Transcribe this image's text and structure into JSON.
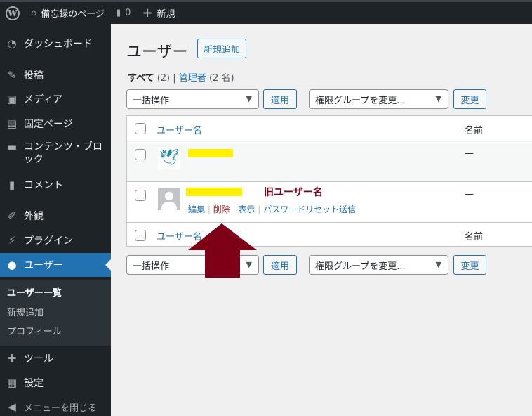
{
  "adminbar": {
    "site_name": "備忘録のページ",
    "comments_count": "0",
    "new_label": "新規"
  },
  "sidebar": {
    "items": [
      {
        "label": "ダッシュボード",
        "icon": "dashboard-icon"
      },
      {
        "label": "投稿",
        "icon": "pin-icon"
      },
      {
        "label": "メディア",
        "icon": "media-icon"
      },
      {
        "label": "固定ページ",
        "icon": "page-icon"
      },
      {
        "label": "コンテンツ・ブロック",
        "icon": "block-icon"
      },
      {
        "label": "コメント",
        "icon": "comment-icon"
      },
      {
        "label": "外観",
        "icon": "brush-icon"
      },
      {
        "label": "プラグイン",
        "icon": "plugin-icon"
      },
      {
        "label": "ユーザー",
        "icon": "user-icon"
      },
      {
        "label": "ツール",
        "icon": "wrench-icon"
      },
      {
        "label": "設定",
        "icon": "settings-icon"
      },
      {
        "label": "メニューを閉じる",
        "icon": "collapse-icon"
      }
    ],
    "submenu": [
      "ユーザー一覧",
      "新規追加",
      "プロフィール"
    ]
  },
  "main": {
    "title": "ユーザー",
    "add_new": "新規追加",
    "filters": {
      "all": "すべて",
      "all_count": "(2)",
      "admin": "管理者",
      "admin_count": "(2 名)"
    },
    "bulk_action": "一括操作",
    "apply": "適用",
    "role_change": "権限グループを変更...",
    "change": "変更",
    "columns": {
      "username": "ユーザー名",
      "name": "名前"
    },
    "rows": [
      {
        "name": "—"
      },
      {
        "name": "—",
        "actions": [
          "編集",
          "削除",
          "表示",
          "パスワードリセット送信"
        ]
      }
    ],
    "annotation": "旧ユーザー名",
    "annotation_color": "#7d0016"
  }
}
